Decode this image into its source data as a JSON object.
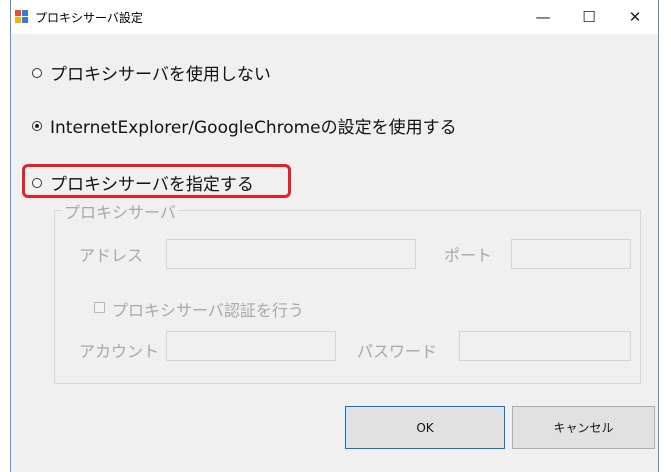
{
  "window": {
    "title": "プロキシサーバ設定",
    "controls": {
      "minimize": "—",
      "maximize": "☐",
      "close": "✕"
    }
  },
  "options": {
    "no_proxy": {
      "label": "プロキシサーバを使用しない",
      "checked": false
    },
    "use_browser": {
      "label": "InternetExplorer/GoogleChromeの設定を使用する",
      "checked": true
    },
    "specify": {
      "label": "プロキシサーバを指定する",
      "checked": false
    }
  },
  "proxy_group": {
    "label": "プロキシサーバ",
    "address_label": "アドレス",
    "address_value": "",
    "port_label": "ポート",
    "port_value": "",
    "auth_label": "プロキシサーバ認証を行う",
    "auth_checked": false,
    "account_label": "アカウント",
    "account_value": "",
    "password_label": "パスワード",
    "password_value": ""
  },
  "buttons": {
    "ok": "OK",
    "cancel": "キャンセル"
  },
  "colors": {
    "highlight": "#e4202a",
    "disabled_text": "#a8a8a8",
    "window_bg": "#f0f0f0",
    "ok_border": "#0078d7"
  },
  "icons": {
    "app": "proxy-settings-icon"
  }
}
